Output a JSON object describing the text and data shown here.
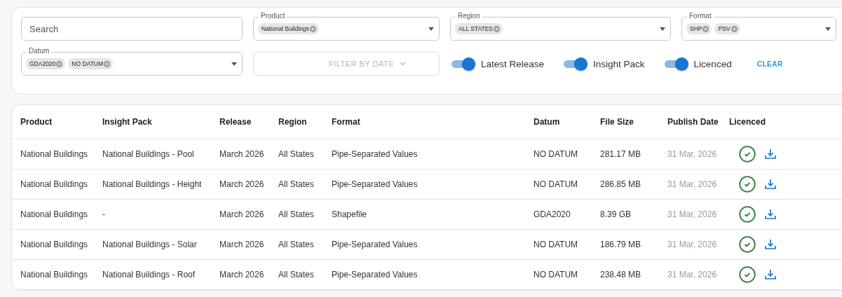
{
  "filters": {
    "search": {
      "placeholder": "Search"
    },
    "selects": [
      {
        "label": "Product",
        "chips": [
          "National Buildings"
        ]
      },
      {
        "label": "Region",
        "chips": [
          "ALL STATES"
        ]
      },
      {
        "label": "Format",
        "chips": [
          "SHP",
          "PSV"
        ]
      },
      {
        "label": "Datum",
        "chips": [
          "GDA2020",
          "NO DATUM"
        ]
      }
    ],
    "date_button": {
      "label": "FILTER BY DATE",
      "disabled": true
    },
    "toggles": [
      {
        "label": "Latest Release",
        "on": true
      },
      {
        "label": "Insight Pack",
        "on": true
      },
      {
        "label": "Licenced",
        "on": true
      }
    ],
    "clear": "CLEAR"
  },
  "table": {
    "columns": [
      "Product",
      "Insight Pack",
      "Release",
      "Region",
      "Format",
      "Datum",
      "File Size",
      "Publish Date",
      "Licenced"
    ],
    "rows": [
      {
        "cells": [
          "National Buildings",
          "National Buildings - Pool",
          "March 2026",
          "All States",
          "Pipe-Separated Values",
          "NO DATUM",
          "281.17 MB",
          "31 Mar, 2026"
        ],
        "licenced": true
      },
      {
        "cells": [
          "National Buildings",
          "National Buildings - Height",
          "March 2026",
          "All States",
          "Pipe-Separated Values",
          "NO DATUM",
          "286.85 MB",
          "31 Mar, 2026"
        ],
        "licenced": true
      },
      {
        "cells": [
          "National Buildings",
          "-",
          "March 2026",
          "All States",
          "Shapefile",
          "GDA2020",
          "8.39 GB",
          "31 Mar, 2026"
        ],
        "licenced": true
      },
      {
        "cells": [
          "National Buildings",
          "National Buildings - Solar",
          "March 2026",
          "All States",
          "Pipe-Separated Values",
          "NO DATUM",
          "186.79 MB",
          "31 Mar, 2026"
        ],
        "licenced": true
      },
      {
        "cells": [
          "National Buildings",
          "National Buildings - Roof",
          "March 2026",
          "All States",
          "Pipe-Separated Values",
          "NO DATUM",
          "238.48 MB",
          "31 Mar, 2026"
        ],
        "licenced": true
      }
    ]
  }
}
